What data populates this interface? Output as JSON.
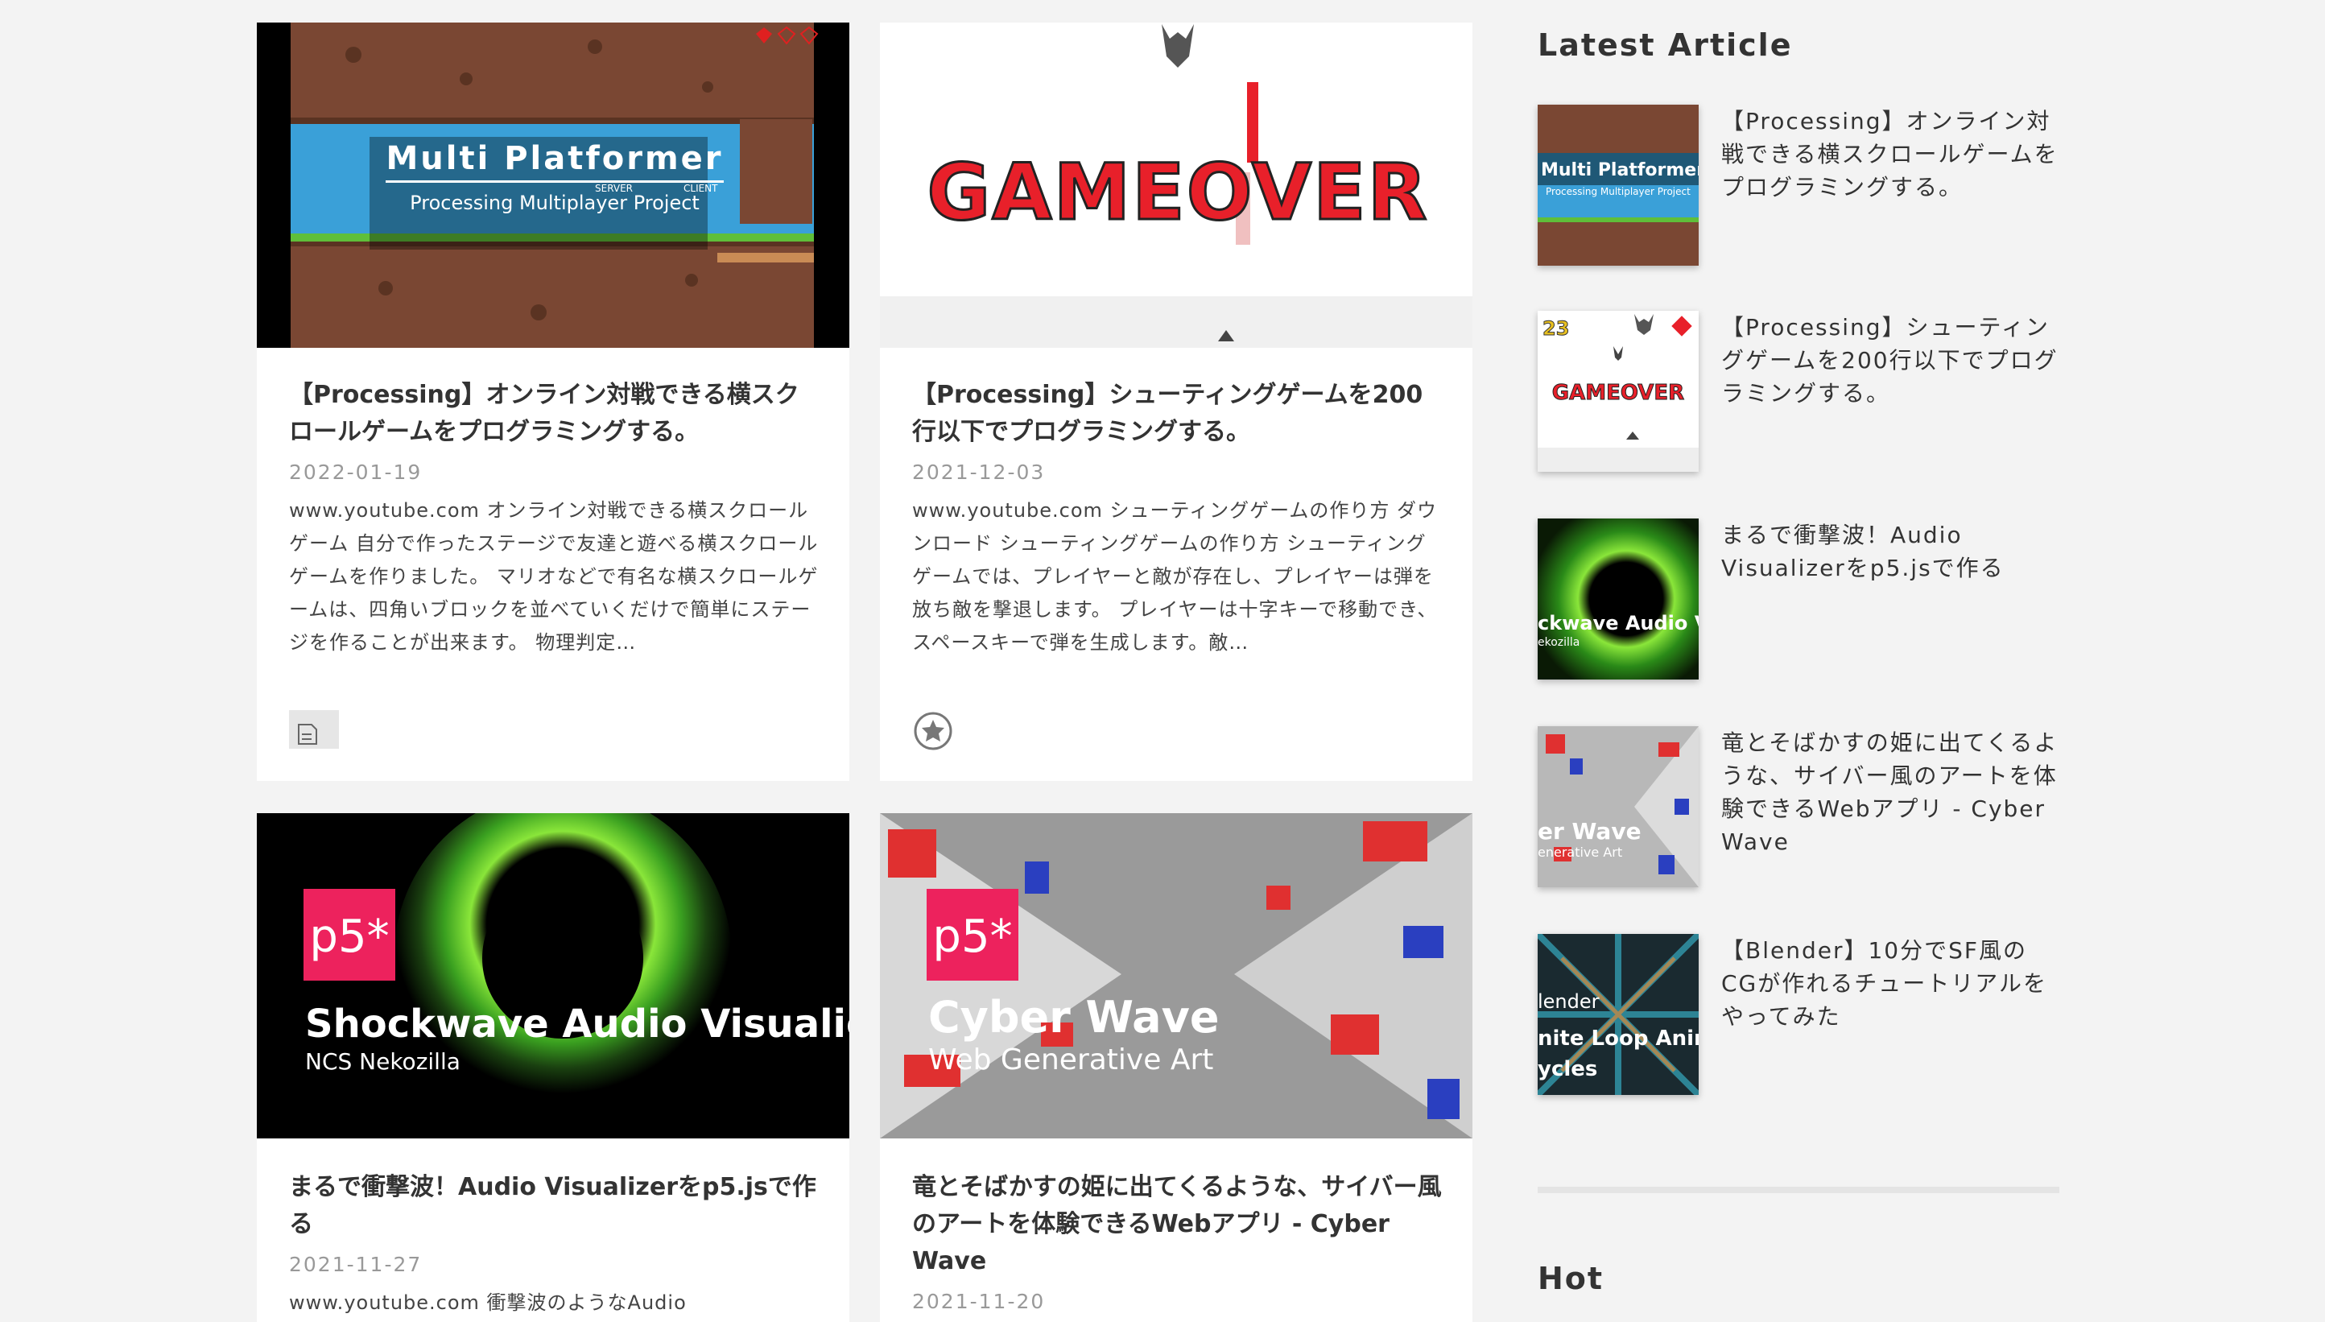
{
  "articles": [
    {
      "title": "【Processing】オンライン対戦できる横スクロールゲームをプログラミングする。",
      "date": "2022-01-19",
      "excerpt": "www.youtube.com オンライン対戦できる横スクロールゲーム 自分で作ったステージで友達と遊べる横スクロールゲームを作りました。 マリオなどで有名な横スクロールゲームは、四角いブロックを並べていくだけで簡単にステージを作ることが出来ます。 物理判定…",
      "thumb_title": "Multi Platformer",
      "thumb_subtitle": "Processing Multiplayer Project",
      "thumb_server": "SERVER",
      "thumb_client": "CLIENT",
      "category_icon": "document-icon"
    },
    {
      "title": "【Processing】シューティングゲームを200行以下でプログラミングする。",
      "date": "2021-12-03",
      "excerpt": "www.youtube.com シューティングゲームの作り方 ダウンロード シューティングゲームの作り方 シューティングゲームでは、プレイヤーと敵が存在し、プレイヤーは弾を放ち敵を撃退します。 プレイヤーは十字キーで移動でき、スペースキーで弾を生成します。敵…",
      "thumb_title": "GAMEOVER",
      "category_icon": "star-icon"
    },
    {
      "title": "まるで衝撃波！Audio Visualizerをp5.jsで作る",
      "date": "2021-11-27",
      "excerpt": "www.youtube.com 衝撃波のようなAudio",
      "thumb_badge": "p5*",
      "thumb_title": "Shockwave Audio Visualier",
      "thumb_subtitle": "NCS Nekozilla"
    },
    {
      "title": "竜とそばかすの姫に出てくるような、サイバー風のアートを体験できるWebアプリ - Cyber Wave",
      "date": "2021-11-20",
      "thumb_badge": "p5*",
      "thumb_title": "Cyber Wave",
      "thumb_subtitle": "Web Generative Art"
    }
  ],
  "sidebar": {
    "latest_heading": "Latest Article",
    "hot_heading": "Hot",
    "items": [
      {
        "title": "【Processing】オンライン対戦できる横スクロールゲームをプログラミングする。",
        "thumb_title": "Multi Platformer",
        "thumb_subtitle": "Processing Multiplayer Project"
      },
      {
        "title": "【Processing】シューティングゲームを200行以下でプログラミングする。",
        "thumb_title": "GAMEOVER",
        "thumb_score": "23"
      },
      {
        "title": "まるで衝撃波！Audio Visualizerをp5.jsで作る",
        "thumb_title": "ckwave Audio Vis",
        "thumb_subtitle": "ekozilla"
      },
      {
        "title": "竜とそばかすの姫に出てくるような、サイバー風のアートを体験できるWebアプリ - Cyber Wave",
        "thumb_title": "er Wave",
        "thumb_subtitle": "enerative Art"
      },
      {
        "title": "【Blender】10分でSF風のCGが作れるチュートリアルをやってみた",
        "thumb_title": "lender",
        "thumb_subtitle": "nite Loop Anim",
        "thumb_subtitle2": "ycles"
      }
    ]
  },
  "colors": {
    "page_bg": "#f3f3f3",
    "card_bg": "#ffffff",
    "p5_pink": "#ed225d",
    "gameover_red": "#e8202a",
    "sky_blue": "#3aa0d8",
    "rock_brown": "#7a4733",
    "text_dark": "#333333",
    "text_muted": "#999999",
    "divider": "#e4e4e4"
  }
}
